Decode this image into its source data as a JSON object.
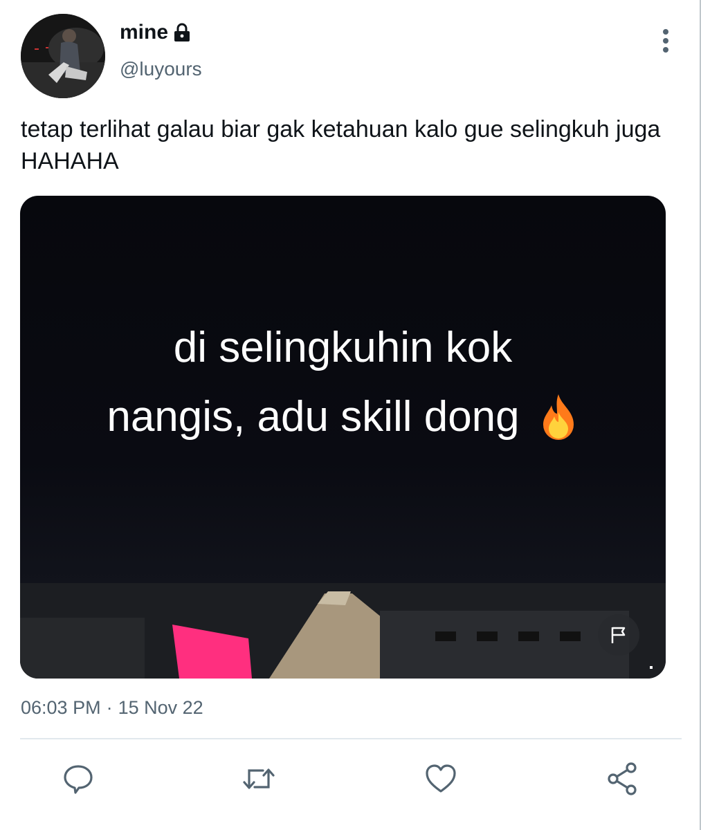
{
  "user": {
    "display_name": "mine",
    "handle": "@luyours",
    "protected_icon": "lock-icon"
  },
  "tweet": {
    "text": "tetap terlihat galau biar gak ketahuan kalo gue selingkuh juga HAHAHA",
    "media_caption_line1": "di selingkuhin kok",
    "media_caption_line2": "nangis, adu skill dong",
    "media_emoji": "fire-icon",
    "time": "06:03 PM",
    "separator": "·",
    "date": "15 Nov 22"
  },
  "actions": [
    "reply-icon",
    "retweet-icon",
    "like-icon",
    "share-icon"
  ],
  "colors": {
    "text_primary": "#0f1419",
    "text_secondary": "#536471",
    "icon": "#536471",
    "divider": "#e1e8ed"
  }
}
